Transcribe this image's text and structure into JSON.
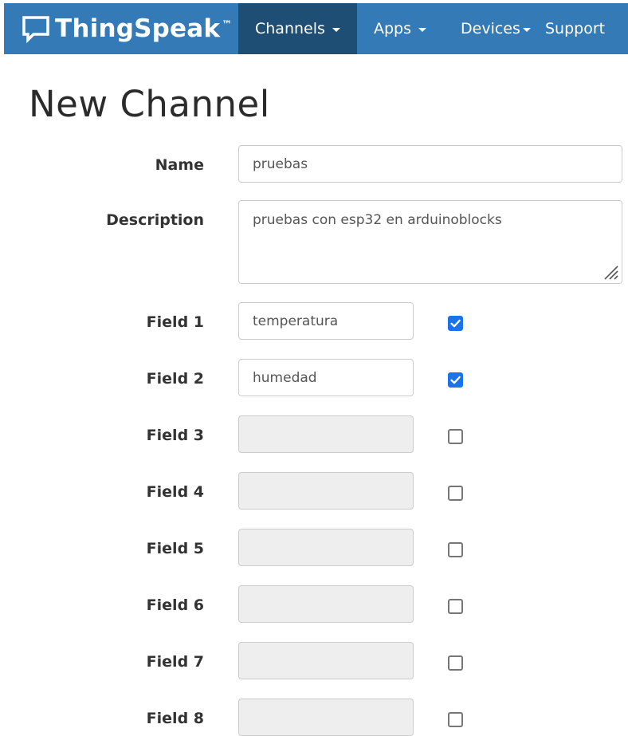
{
  "navbar": {
    "brand": "ThingSpeak",
    "brand_mark": "™",
    "brand_icon": "chat-bubble-icon",
    "items": [
      {
        "label": "Channels",
        "active": true,
        "dropdown": true
      },
      {
        "label": "Apps",
        "active": false,
        "dropdown": true
      },
      {
        "label": "Devices",
        "active": false,
        "dropdown": true
      },
      {
        "label": "Support",
        "active": false,
        "dropdown": false
      }
    ],
    "colors": {
      "background": "#337ab7",
      "active": "#1f4e74"
    }
  },
  "page": {
    "title": "New Channel"
  },
  "form": {
    "name": {
      "label": "Name",
      "value": "pruebas"
    },
    "description": {
      "label": "Description",
      "value": "pruebas con esp32 en arduinoblocks"
    },
    "fields": [
      {
        "label": "Field 1",
        "value": "temperatura",
        "enabled": true
      },
      {
        "label": "Field 2",
        "value": "humedad",
        "enabled": true
      },
      {
        "label": "Field 3",
        "value": "",
        "enabled": false
      },
      {
        "label": "Field 4",
        "value": "",
        "enabled": false
      },
      {
        "label": "Field 5",
        "value": "",
        "enabled": false
      },
      {
        "label": "Field 6",
        "value": "",
        "enabled": false
      },
      {
        "label": "Field 7",
        "value": "",
        "enabled": false
      },
      {
        "label": "Field 8",
        "value": "",
        "enabled": false
      }
    ],
    "checkbox_color": "#1a73e8"
  }
}
